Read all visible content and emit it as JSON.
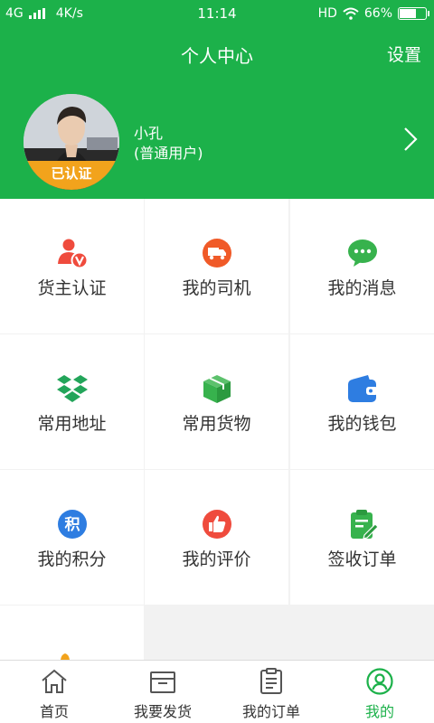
{
  "status_bar": {
    "network": "4G",
    "speed": "4K/s",
    "time": "11:14",
    "hd": "HD",
    "battery_percent": "66%",
    "battery_level": 0.66
  },
  "header": {
    "title": "个人中心",
    "settings_label": "设置",
    "avatar_badge": "已认证",
    "user_name": "小孔",
    "user_role": "(普通用户)"
  },
  "menu": [
    {
      "label": "货主认证",
      "icon": "person-verified-icon",
      "color": "#ef4b3d"
    },
    {
      "label": "我的司机",
      "icon": "truck-icon",
      "color": "#f05a28"
    },
    {
      "label": "我的消息",
      "icon": "chat-bubble-icon",
      "color": "#37b24d"
    },
    {
      "label": "常用地址",
      "icon": "boxes-icon",
      "color": "#23a55a"
    },
    {
      "label": "常用货物",
      "icon": "package-icon",
      "color": "#37b24d"
    },
    {
      "label": "我的钱包",
      "icon": "wallet-icon",
      "color": "#2e7de1"
    },
    {
      "label": "我的积分",
      "icon": "points-icon",
      "color": "#2e7de1"
    },
    {
      "label": "我的评价",
      "icon": "thumbs-up-icon",
      "color": "#ef4b3d"
    },
    {
      "label": "签收订单",
      "icon": "clipboard-sign-icon",
      "color": "#37b24d"
    }
  ],
  "tabs": [
    {
      "label": "首页",
      "icon": "home-icon"
    },
    {
      "label": "我要发货",
      "icon": "inbox-icon"
    },
    {
      "label": "我的订单",
      "icon": "order-list-icon"
    },
    {
      "label": "我的",
      "icon": "profile-icon",
      "active": true
    }
  ],
  "accent_color": "#1cb14a"
}
